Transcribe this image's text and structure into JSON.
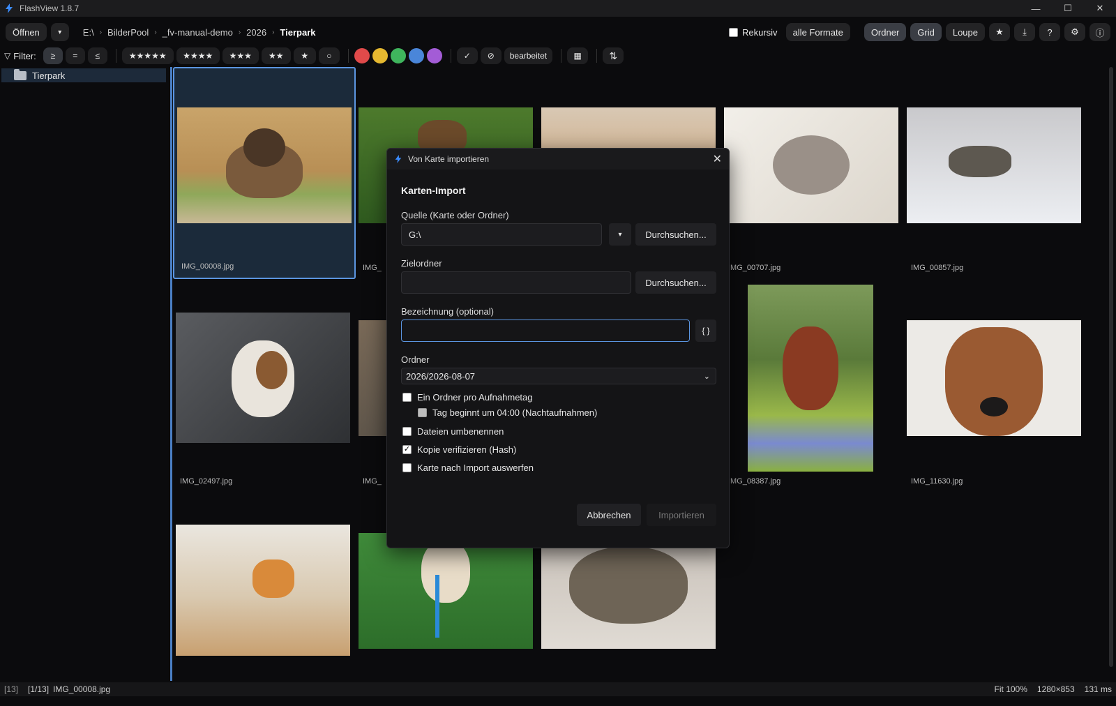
{
  "window": {
    "title": "FlashView 1.8.7",
    "controls": [
      "—",
      "☐",
      "✕"
    ]
  },
  "toolbar": {
    "open_label": "Öffnen",
    "open_dropdown": "▾",
    "breadcrumb": [
      "E:\\",
      "BilderPool",
      "_fv-manual-demo",
      "2026",
      "Tierpark"
    ],
    "recursive_label": "Rekursiv",
    "formats_label": "alle Formate",
    "view_buttons": [
      "Ordner",
      "Grid",
      "Loupe"
    ],
    "icons": [
      "★",
      "⤓",
      "?",
      "⚙",
      "ⓘ"
    ]
  },
  "filterbar": {
    "label": "Filter:",
    "compare": [
      "≥",
      "=",
      "≤"
    ],
    "ratings": [
      "★★★★★",
      "★★★★",
      "★★★",
      "★★",
      "★",
      "○"
    ],
    "colors": [
      "#e04a4a",
      "#e5b830",
      "#3fb55d",
      "#4a86d9",
      "#a35cd6"
    ],
    "check": "✓",
    "reject": "⊘",
    "edited": "bearbeitet",
    "calendar": "▦",
    "sort": "⇅"
  },
  "sidebar": {
    "folder": "Tierpark"
  },
  "grid": {
    "items": [
      {
        "name": "IMG_00008.jpg",
        "selected": true
      },
      {
        "name": "IMG_",
        "selected": false
      },
      {
        "name": "",
        "selected": false
      },
      {
        "name": "IMG_00707.jpg",
        "selected": false
      },
      {
        "name": "IMG_00857.jpg",
        "selected": false
      },
      {
        "name": "IMG_02497.jpg",
        "selected": false
      },
      {
        "name": "IMG_",
        "selected": false
      },
      {
        "name": "",
        "selected": false
      },
      {
        "name": "IMG_08387.jpg",
        "selected": false
      },
      {
        "name": "IMG_11630.jpg",
        "selected": false
      },
      {
        "name": "",
        "selected": false
      },
      {
        "name": "",
        "selected": false
      },
      {
        "name": "",
        "selected": false
      }
    ]
  },
  "statusbar": {
    "count": "[13]",
    "position": "[1/13]",
    "file": "IMG_00008.jpg",
    "zoom": "Fit 100%",
    "dimensions": "1280×853",
    "time": "131 ms"
  },
  "dialog": {
    "title": "Von Karte importieren",
    "heading": "Karten-Import",
    "source_label": "Quelle (Karte oder Ordner)",
    "source_value": "G:\\",
    "browse_label": "Durchsuchen...",
    "target_label": "Zielordner",
    "target_value": "",
    "name_label": "Bezeichnung (optional)",
    "name_value": "",
    "token_button": "{ }",
    "folder_label": "Ordner",
    "folder_value": "2026/2026-08-07",
    "options": [
      {
        "label": "Ein Ordner pro Aufnahmetag",
        "checked": false
      },
      {
        "label": "Tag beginnt um 04:00 (Nachtaufnahmen)",
        "checked": false
      },
      {
        "label": "Dateien umbenennen",
        "checked": false
      },
      {
        "label": "Kopie verifizieren (Hash)",
        "checked": true
      },
      {
        "label": "Karte nach Import auswerfen",
        "checked": false
      }
    ],
    "cancel_label": "Abbrechen",
    "import_label": "Importieren"
  }
}
